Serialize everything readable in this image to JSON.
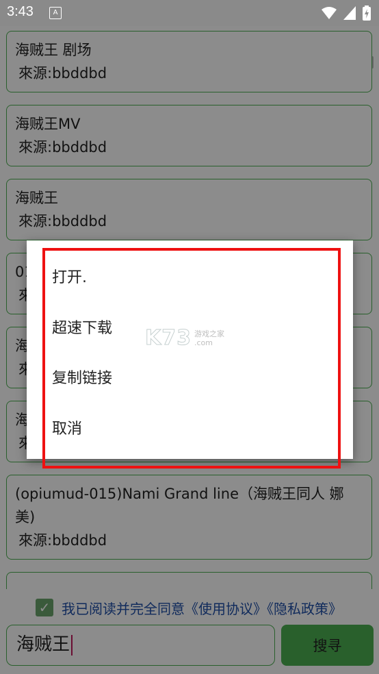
{
  "status_bar": {
    "time": "3:43",
    "notification_icon": "A"
  },
  "results": [
    {
      "title": "海贼王 剧场",
      "source": "來源:bbddbd"
    },
    {
      "title": "海贼王MV",
      "source": "來源:bbddbd"
    },
    {
      "title": "海贼王",
      "source": "來源:bbddbd"
    },
    {
      "title": "01",
      "source": "來"
    },
    {
      "title": "海",
      "source": "來"
    },
    {
      "title": "海",
      "source": "來"
    },
    {
      "title": "(opiumud-015)Nami Grand line（海贼王同人 娜美)",
      "source": "來源:bbddbd"
    }
  ],
  "agreement": {
    "checked": true,
    "text": "我已阅读并完全同意《使用协议》《隐私政策》"
  },
  "search": {
    "value": "海贼王",
    "button_label": "搜寻"
  },
  "dialog": {
    "items": [
      "打开.",
      "超速下载",
      "复制链接",
      "取消"
    ]
  },
  "watermark": {
    "main": "K73",
    "sub_top": "游戏之家",
    "sub_bottom": ".com"
  },
  "colors": {
    "accent_green": "#4caf50",
    "link_blue": "#1f4fa8",
    "highlight_red": "#ee1111"
  }
}
